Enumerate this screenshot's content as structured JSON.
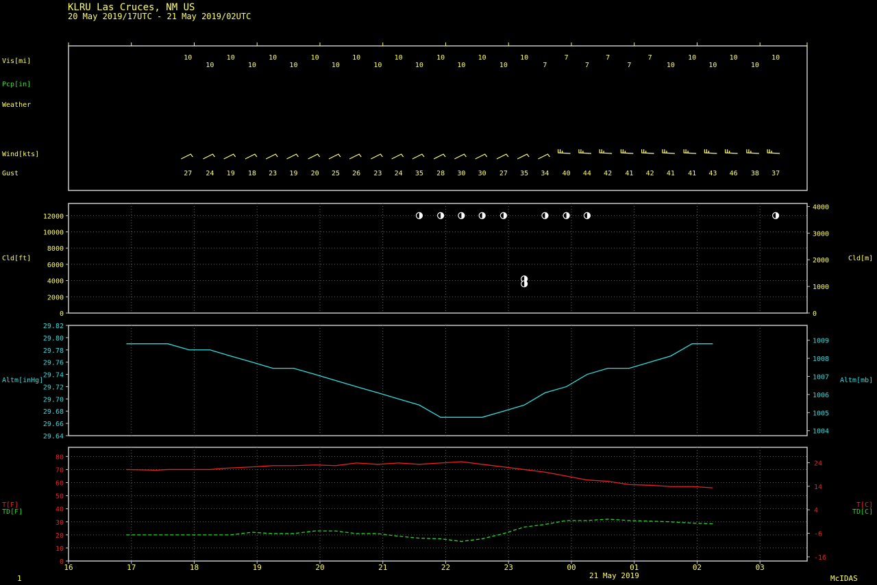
{
  "header": {
    "title": "KLRU  Las Cruces, NM US",
    "subtitle": "20 May 2019/17UTC - 21 May 2019/02UTC"
  },
  "footer": {
    "page_number": "1",
    "date_label": "21 May 2019",
    "software": "McIDAS"
  },
  "colors": {
    "background": "#000000",
    "frame": "#c8c8c8",
    "label_yellow": "#ffff66",
    "label_green": "#33dd33",
    "altimeter": "#33dddd",
    "temperature": "#ee2222",
    "dewpoint": "#22dd22",
    "cloud_symbol": "#ffffff"
  },
  "chart_data": [
    {
      "type": "table",
      "panel": "surface-observations",
      "x_hours": [
        17.9,
        18.25,
        18.58,
        18.92,
        19.25,
        19.58,
        19.92,
        20.25,
        20.58,
        20.92,
        21.25,
        21.58,
        21.92,
        22.25,
        22.58,
        22.92,
        23.25,
        23.58,
        23.92,
        24.25,
        24.58,
        24.92,
        25.25,
        25.58,
        25.92,
        26.25,
        26.58,
        26.92,
        27.25
      ],
      "rows": [
        {
          "label": "Vis[mi]",
          "values": [
            "10",
            "10",
            "10",
            "10",
            "10",
            "10",
            "10",
            "10",
            "10",
            "10",
            "10",
            "10",
            "10",
            "10",
            "10",
            "10",
            "10",
            "10",
            "7",
            "7",
            "7",
            "7",
            "7",
            "7",
            "7",
            "10",
            "10",
            "10",
            "10",
            "10",
            "10"
          ]
        },
        {
          "label": "Pcp[in]",
          "values": []
        },
        {
          "label": "Weather",
          "values": []
        },
        {
          "label": "Wind[kts]",
          "values": [
            "barb",
            "barb",
            "barb",
            "barb",
            "barb",
            "barb",
            "barb",
            "barb",
            "barb",
            "barb",
            "barb",
            "barb",
            "barb",
            "barb",
            "barb",
            "barb",
            "barb",
            "barb",
            "barb",
            "barb",
            "barb",
            "barb",
            "barb",
            "barb",
            "barb",
            "barb",
            "barb",
            "barb",
            "barb"
          ]
        },
        {
          "label": "Gust",
          "values": [
            "27",
            "24",
            "19",
            "18",
            "23",
            "19",
            "20",
            "25",
            "26",
            "23",
            "24",
            "35",
            "28",
            "30",
            "30",
            "27",
            "35",
            "34",
            "40",
            "44",
            "42",
            "41",
            "42",
            "41",
            "41",
            "43",
            "46",
            "38",
            "37"
          ]
        }
      ],
      "vis_x_hours": [
        17.9,
        18.25,
        18.58,
        18.92,
        19.25,
        19.58,
        19.92,
        20.25,
        20.58,
        20.92,
        21.25,
        21.58,
        21.92,
        22.25,
        22.58,
        22.92,
        23.25,
        23.58,
        23.92,
        24.25,
        24.58,
        24.92,
        25.25,
        25.58,
        25.92,
        26.25,
        26.58,
        26.92,
        27.25
      ],
      "vis_values": [
        "10",
        "10",
        "10",
        "10",
        "10",
        "10",
        "10",
        "10",
        "10",
        "10",
        "10",
        "10",
        "10",
        "10",
        "10",
        "10",
        "10",
        "7",
        "7",
        "7",
        "7",
        "7",
        "7",
        "10",
        "10",
        "10",
        "10",
        "10",
        "10"
      ],
      "wind_kts_by_obs": [
        null,
        null,
        null,
        null,
        null,
        null,
        null,
        null,
        null,
        null,
        null,
        null,
        null,
        null,
        null,
        null,
        null,
        null,
        null,
        null,
        null,
        null,
        null,
        null,
        null,
        null,
        null,
        null,
        null
      ]
    },
    {
      "type": "scatter",
      "panel": "cloud-height",
      "ylabel_left": "Cld[ft]",
      "ylabel_right": "Cld[m]",
      "ylim": [
        0,
        13500
      ],
      "y_ticks_left": [
        0,
        2000,
        4000,
        6000,
        8000,
        10000,
        12000
      ],
      "y_ticks_right": [
        0,
        1000,
        2000,
        3000,
        4000
      ],
      "x_hours": [
        21.58,
        21.92,
        22.25,
        22.58,
        22.92,
        23.25,
        23.25,
        23.58,
        23.92,
        24.25,
        27.25
      ],
      "values": [
        12000,
        12000,
        12000,
        12000,
        12000,
        4200,
        3600,
        12000,
        12000,
        12000,
        12000
      ],
      "symbol": "half-filled circle"
    },
    {
      "type": "line",
      "panel": "altimeter",
      "ylabel_left": "Altm[inHg]",
      "ylabel_right": "Altm[mb]",
      "ylim": [
        29.64,
        29.82
      ],
      "y_ticks_left": [
        "29.64",
        "29.66",
        "29.68",
        "29.70",
        "29.72",
        "29.74",
        "29.76",
        "29.78",
        "29.80",
        "29.82"
      ],
      "y_ticks_right": [
        "1004",
        "1005",
        "1006",
        "1007",
        "1008",
        "1009"
      ],
      "x": [
        16.92,
        17.58,
        17.92,
        18.25,
        18.58,
        18.92,
        19.25,
        19.58,
        19.92,
        20.25,
        20.58,
        20.92,
        21.25,
        21.58,
        21.92,
        22.25,
        22.58,
        22.92,
        23.25,
        23.58,
        23.92,
        24.25,
        24.58,
        24.92,
        25.25,
        25.58,
        25.92,
        26.25
      ],
      "values": [
        29.79,
        29.79,
        29.78,
        29.78,
        29.77,
        29.76,
        29.75,
        29.75,
        29.74,
        29.73,
        29.72,
        29.71,
        29.7,
        29.69,
        29.67,
        29.67,
        29.67,
        29.68,
        29.69,
        29.71,
        29.72,
        29.74,
        29.75,
        29.75,
        29.76,
        29.77,
        29.79,
        29.79
      ]
    },
    {
      "type": "line",
      "panel": "temperature-dewpoint",
      "ylabel_left_1": "T[F]",
      "ylabel_left_2": "TD[F]",
      "ylabel_right_1": "T[C]",
      "ylabel_right_2": "TD[C]",
      "ylim": [
        0,
        87
      ],
      "y_ticks_left": [
        "0",
        "10",
        "20",
        "30",
        "40",
        "50",
        "60",
        "70",
        "80"
      ],
      "y_ticks_right": [
        "-16",
        "-6",
        "4",
        "14",
        "24"
      ],
      "x_ticks": [
        "16",
        "17",
        "18",
        "19",
        "20",
        "21",
        "22",
        "23",
        "00",
        "01",
        "02",
        "03"
      ],
      "xlim": [
        16,
        27.75
      ],
      "series": [
        {
          "name": "T[F]",
          "x": [
            16.92,
            17.4,
            17.58,
            17.92,
            18.25,
            18.5,
            18.92,
            19.25,
            19.58,
            19.92,
            20.25,
            20.58,
            20.92,
            21.25,
            21.58,
            21.92,
            22.25,
            22.58,
            22.92,
            23.25,
            23.58,
            23.92,
            24.25,
            24.58,
            24.92,
            25.25,
            25.58,
            25.92,
            26.25
          ],
          "values": [
            70,
            69.5,
            70,
            70,
            70,
            71,
            72,
            73,
            73,
            73.5,
            73,
            75,
            74,
            75,
            74,
            75,
            76,
            74,
            72,
            70,
            68,
            65,
            62,
            61,
            58.5,
            58,
            57,
            57,
            56
          ]
        },
        {
          "name": "TD[F]",
          "x": [
            16.92,
            17.58,
            17.92,
            18.25,
            18.58,
            18.92,
            19.25,
            19.58,
            19.92,
            20.25,
            20.58,
            20.92,
            21.25,
            21.58,
            21.92,
            22.25,
            22.58,
            22.92,
            23.25,
            23.58,
            23.92,
            24.25,
            24.58,
            24.92,
            25.25,
            25.58,
            25.92,
            26.25
          ],
          "values": [
            20,
            20,
            20,
            20,
            20,
            22,
            21,
            21,
            23,
            23,
            21,
            21,
            19,
            17.5,
            17,
            15,
            17,
            21,
            26,
            28,
            31,
            31,
            32,
            31,
            30.5,
            30,
            29,
            28.5
          ]
        }
      ]
    }
  ]
}
